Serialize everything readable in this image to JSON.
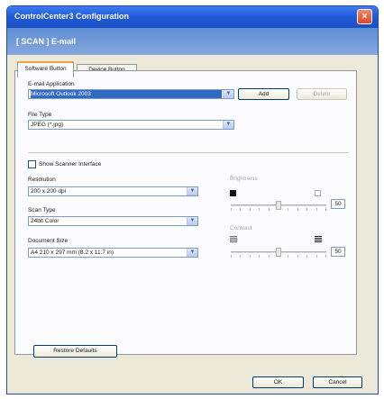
{
  "window": {
    "title": "ControlCenter3 Configuration",
    "close_glyph": "×"
  },
  "header": {
    "text": "[ SCAN ]  E-mail"
  },
  "tabs": [
    {
      "label": "Software Button",
      "active": true
    },
    {
      "label": "Device Button",
      "active": false
    }
  ],
  "email_application": {
    "label": "E-mail Application",
    "value": "Microsoft Outlook 2003",
    "add_label": "Add",
    "delete_label": "Delete"
  },
  "file_type": {
    "label": "File Type",
    "value": "JPEG (*.jpg)"
  },
  "show_scanner_interface": {
    "label": "Show Scanner Interface",
    "checked": false
  },
  "resolution": {
    "label": "Resolution",
    "value": "200 x 200 dpi"
  },
  "scan_type": {
    "label": "Scan Type",
    "value": "24bit Color"
  },
  "document_size": {
    "label": "Document Size",
    "value": "A4 210 x 297 mm (8.2 x 11.7 in)"
  },
  "brightness": {
    "label": "Brightness",
    "value": "50",
    "level_percent": 50
  },
  "contrast": {
    "label": "Contrast",
    "value": "50",
    "level_percent": 50
  },
  "restore_defaults_label": "Restore Defaults",
  "ok_label": "OK",
  "cancel_label": "Cancel",
  "dropdown_glyph": "▼",
  "colors": {
    "title_bar": "#1f5bd9",
    "header_band": "#6f97d8",
    "selection": "#316ac5",
    "dialog_bg": "#ece9d8"
  }
}
